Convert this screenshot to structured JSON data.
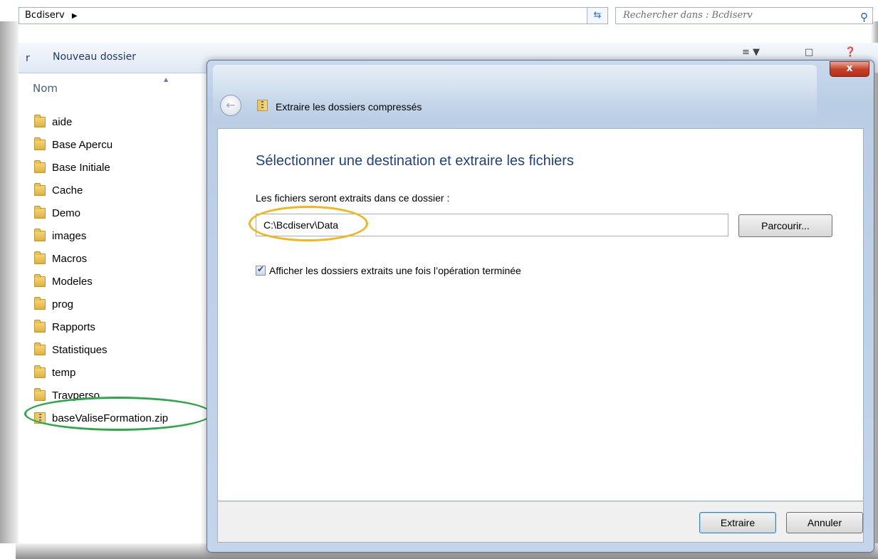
{
  "explorer": {
    "address": {
      "crumb": "Bcdiserv"
    },
    "search": {
      "placeholder": "Rechercher dans : Bcdiserv"
    },
    "toolbar": {
      "new_folder": "Nouveau dossier"
    },
    "column_header": "Nom",
    "items": [
      {
        "name": "aide",
        "type": "folder"
      },
      {
        "name": "Base Apercu",
        "type": "folder"
      },
      {
        "name": "Base Initiale",
        "type": "folder"
      },
      {
        "name": "Cache",
        "type": "folder"
      },
      {
        "name": "Demo",
        "type": "folder"
      },
      {
        "name": "images",
        "type": "folder"
      },
      {
        "name": "Macros",
        "type": "folder"
      },
      {
        "name": "Modeles",
        "type": "folder"
      },
      {
        "name": "prog",
        "type": "folder"
      },
      {
        "name": "Rapports",
        "type": "folder"
      },
      {
        "name": "Statistiques",
        "type": "folder"
      },
      {
        "name": "temp",
        "type": "folder"
      },
      {
        "name": "Travperso",
        "type": "folder"
      },
      {
        "name": "baseValiseFormation.zip",
        "type": "zip"
      }
    ]
  },
  "dialog": {
    "title": "Extraire les dossiers compressés",
    "close_label": "x",
    "heading": "Sélectionner une destination et extraire les fichiers",
    "destination_label": "Les fichiers seront extraits dans ce dossier :",
    "destination_value": "C:\\Bcdiserv\\Data",
    "browse_label": "Parcourir...",
    "show_checkbox_label": "Afficher les dossiers extraits une fois l’opération terminée",
    "show_checkbox_checked": true,
    "extract_label": "Extraire",
    "cancel_label": "Annuler"
  },
  "colors": {
    "heading": "#1e3f8a",
    "highlight_zip": "#2fa64a",
    "highlight_path": "#f4b41a",
    "close_button": "#c7412a"
  }
}
